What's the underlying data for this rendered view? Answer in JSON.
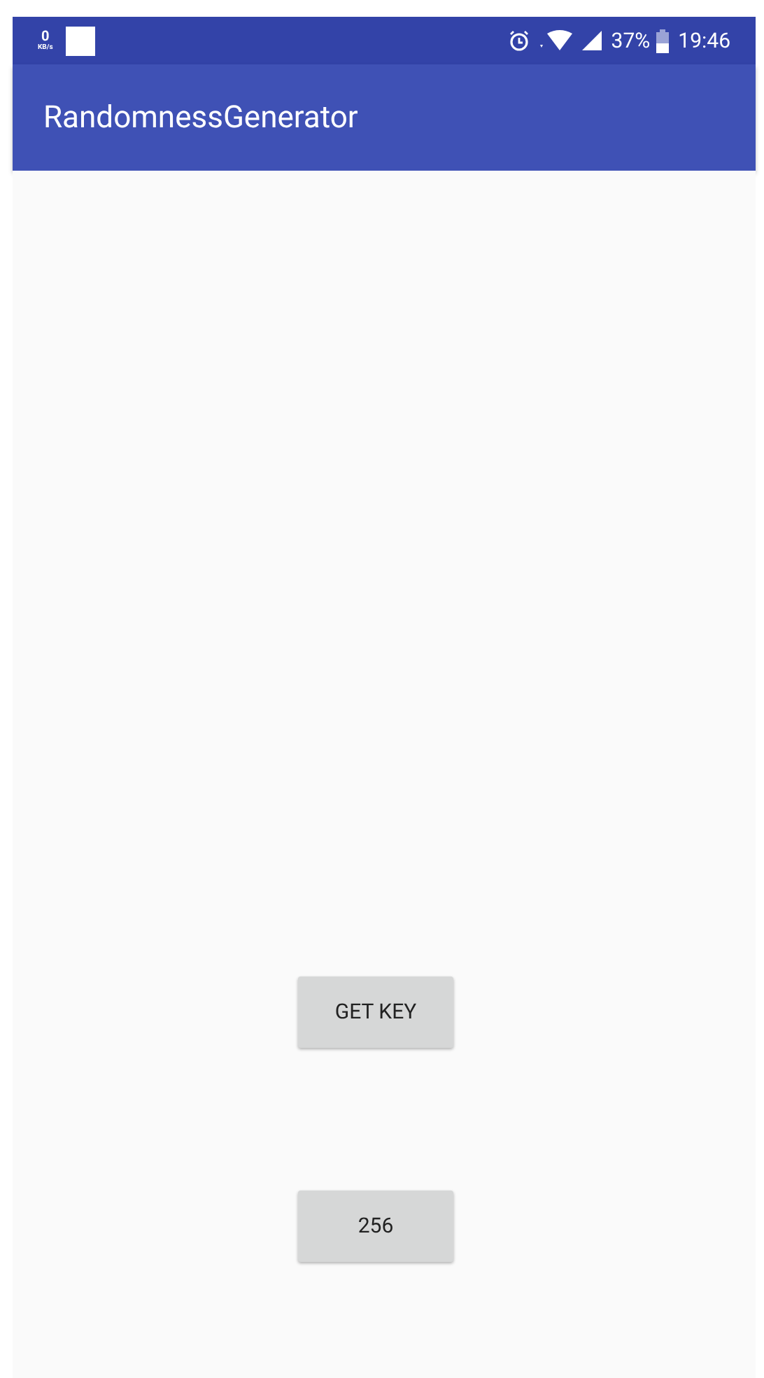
{
  "status_bar": {
    "speed_value": "0",
    "speed_unit": "KB/s",
    "battery": "37%",
    "time": "19:46"
  },
  "app_bar": {
    "title": "RandomnessGenerator"
  },
  "buttons": [
    {
      "label": "GET KEY"
    },
    {
      "label": "256"
    }
  ]
}
